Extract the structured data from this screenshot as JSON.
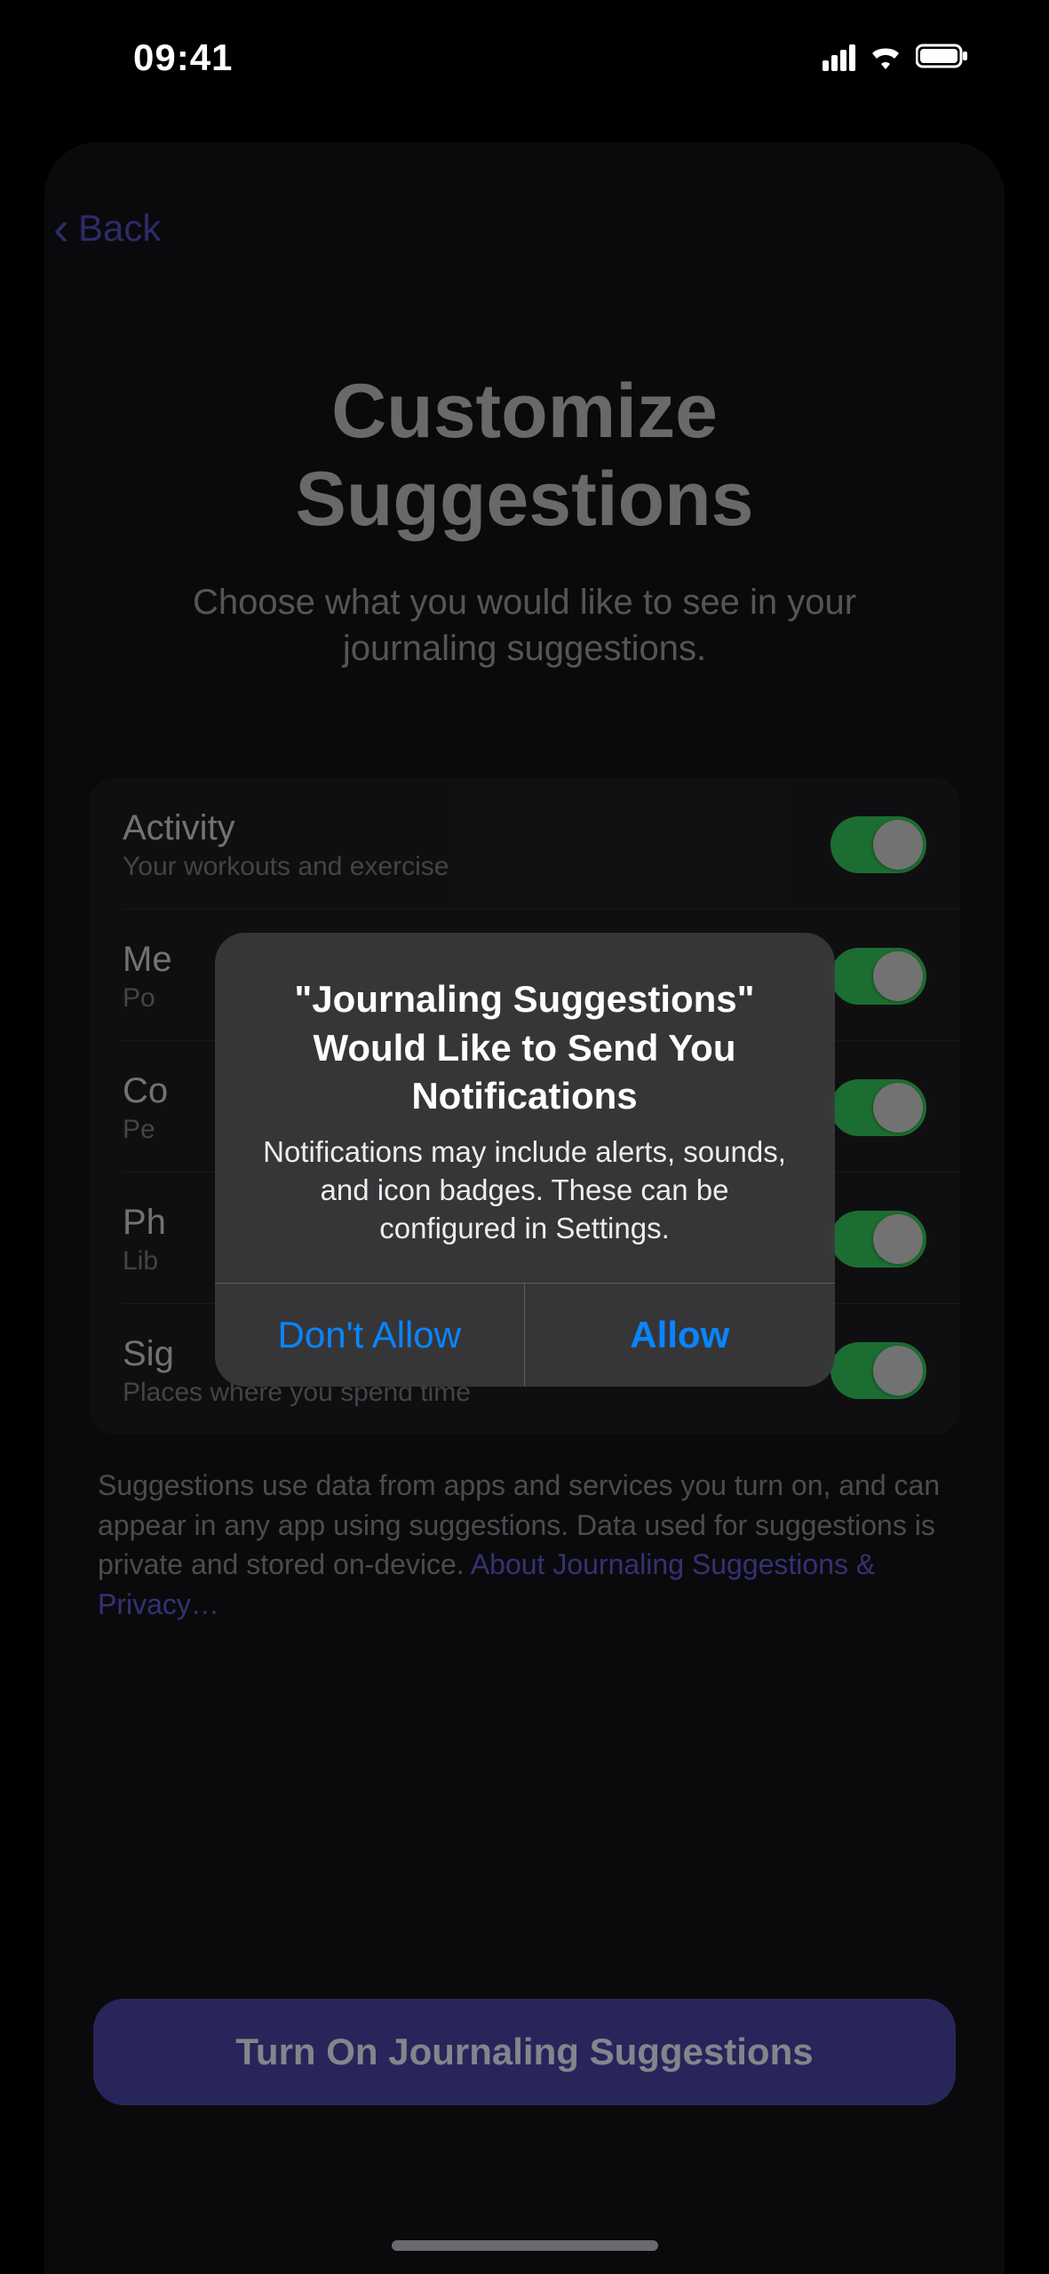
{
  "status": {
    "time": "09:41"
  },
  "nav": {
    "back": "Back"
  },
  "page": {
    "title_l1": "Customize",
    "title_l2": "Suggestions",
    "subtitle": "Choose what you would like to see in your journaling suggestions."
  },
  "rows": {
    "r0": {
      "title": "Activity",
      "sub": "Your workouts and exercise"
    },
    "r1": {
      "title": "Me",
      "sub": "Po"
    },
    "r2": {
      "title": "Co",
      "sub": "Pe"
    },
    "r3": {
      "title": "Ph",
      "sub": "Lib"
    },
    "r4": {
      "title": "Sig",
      "sub": "Places where you spend time"
    }
  },
  "footer": {
    "text": "Suggestions use data from apps and services you turn on, and can appear in any app using suggestions. Data used for suggestions is private and stored on-device. ",
    "link": "About Journaling Suggestions & Privacy…"
  },
  "cta": "Turn On Journaling Suggestions",
  "alert": {
    "title": "\"Journaling Suggestions\" Would Like to Send You Notifications",
    "message": "Notifications may include alerts, sounds, and icon badges. These can be configured in Settings.",
    "deny": "Don't Allow",
    "allow": "Allow"
  }
}
